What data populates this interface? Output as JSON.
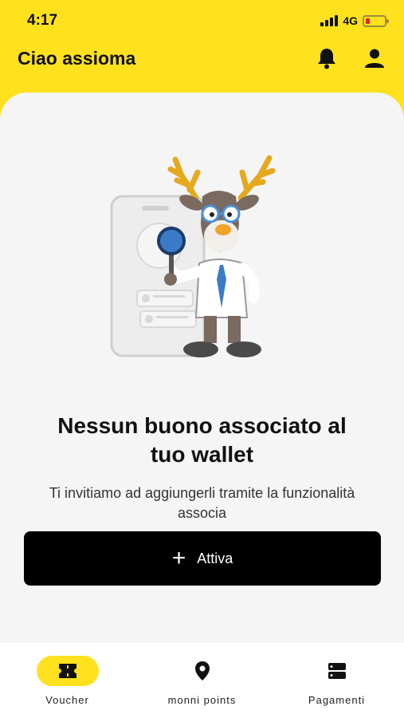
{
  "status_bar": {
    "time": "4:17",
    "network": "4G"
  },
  "header": {
    "title": "Ciao assioma"
  },
  "empty_state": {
    "title": "Nessun buono associato al tuo wallet",
    "subtitle": "Ti invitiamo ad aggiungerli tramite la funzionalità associa"
  },
  "activate_button": {
    "label": "Attiva"
  },
  "bottom_nav": {
    "items": [
      {
        "label": "Voucher",
        "icon": "ticket-icon",
        "active": true
      },
      {
        "label": "monni points",
        "icon": "location-pin-icon",
        "active": false
      },
      {
        "label": "Pagamenti",
        "icon": "server-list-icon",
        "active": false
      }
    ]
  },
  "colors": {
    "brand_yellow": "#FFE11E",
    "background": "#F5F5F5",
    "button": "#000000"
  }
}
